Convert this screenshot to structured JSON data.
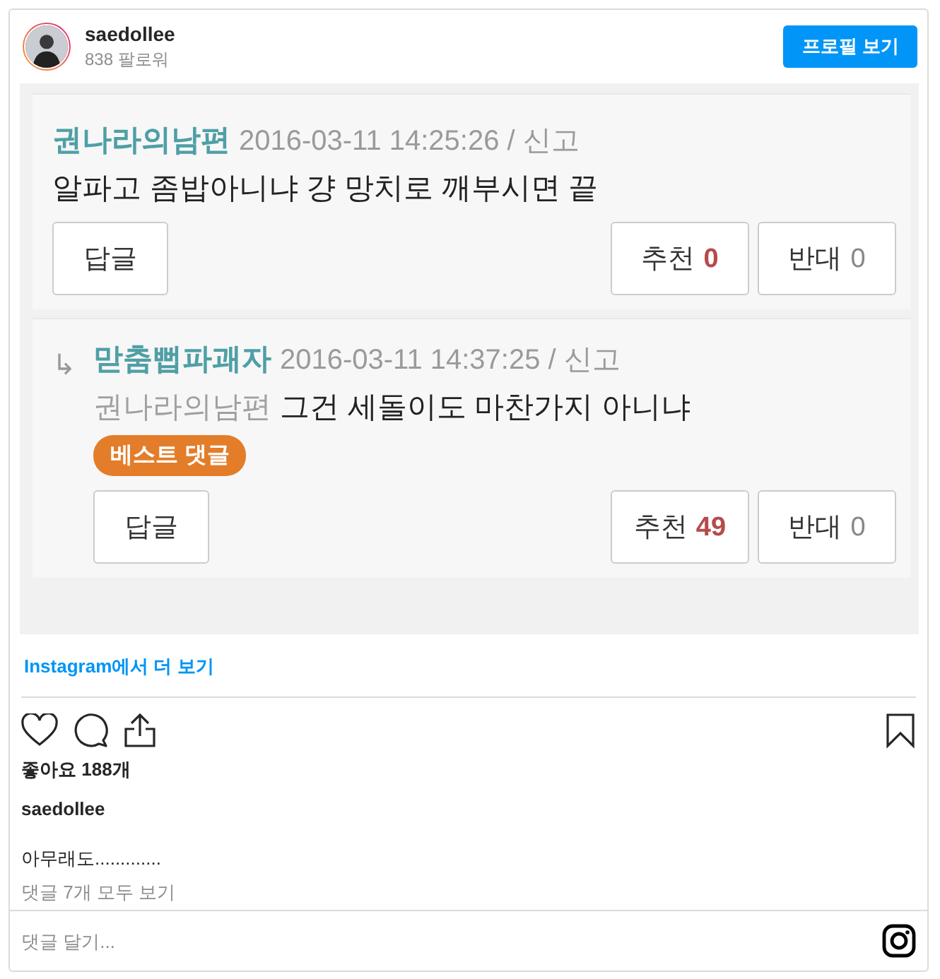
{
  "account": {
    "username": "saedollee",
    "followers": "838 팔로워",
    "profile_button": "프로필 보기"
  },
  "post_image": {
    "comments": [
      {
        "kind": "comment",
        "author": "권나라의남편",
        "meta": "2016-03-11 14:25:26 / 신고",
        "text": "알파고 좀밥아니냐 걍 망치로 깨부시면 끝",
        "reply_button": "답글",
        "up_label": "추천",
        "up_count": "0",
        "down_label": "반대",
        "down_count": "0"
      },
      {
        "kind": "reply",
        "arrow": "↳",
        "author": "맏춤뻡파괘자",
        "meta": "2016-03-11 14:37:25 / 신고",
        "mention": "권나라의남편",
        "text": "그건 세돌이도 마찬가지 아니냐",
        "badge": "베스트 댓글",
        "reply_button": "답글",
        "up_label": "추천",
        "up_count": "49",
        "down_label": "반대",
        "down_count": "0"
      }
    ]
  },
  "more_link": "Instagram에서 더 보기",
  "likes": "좋아요 188개",
  "caption_user": "saedollee",
  "caption": "아무래도.............",
  "view_comments": "댓글 7개 모두 보기",
  "comment_input": {
    "placeholder": "댓글 달기..."
  }
}
